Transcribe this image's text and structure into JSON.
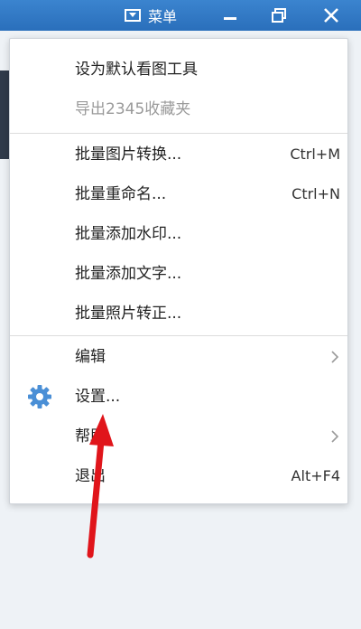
{
  "titlebar": {
    "menu_label": "菜单",
    "icons": {
      "menu": "menu-box-icon",
      "minimize": "minimize-icon",
      "restore": "restore-icon",
      "close": "close-icon"
    }
  },
  "colors": {
    "titlebar": "#2f78c4",
    "gear": "#4a8fd6",
    "arrow": "#e0151b",
    "disabled_text": "#9a9a9a"
  },
  "menu": {
    "items": [
      {
        "label": "设为默认看图工具",
        "shortcut": "",
        "disabled": false
      },
      {
        "label": "导出2345收藏夹",
        "shortcut": "",
        "disabled": true
      },
      {
        "label": "批量图片转换...",
        "shortcut": "Ctrl+M"
      },
      {
        "label": "批量重命名...",
        "shortcut": "Ctrl+N"
      },
      {
        "label": "批量添加水印...",
        "shortcut": ""
      },
      {
        "label": "批量添加文字...",
        "shortcut": ""
      },
      {
        "label": "批量照片转正...",
        "shortcut": ""
      },
      {
        "label": "编辑",
        "submenu": true
      },
      {
        "label": "设置...",
        "icon": "gear-icon"
      },
      {
        "label": "帮助",
        "submenu": true
      },
      {
        "label": "退出",
        "shortcut": "Alt+F4"
      }
    ]
  }
}
